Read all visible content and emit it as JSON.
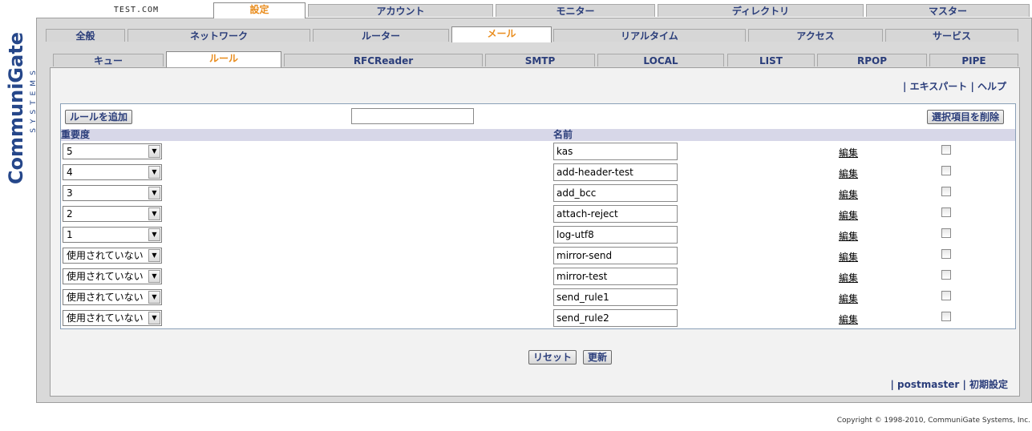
{
  "logo": {
    "brand_a": "Communi",
    "brand_b": "Gate",
    "systems": "SYSTEMS"
  },
  "top_tabs": {
    "host": "TEST.COM",
    "items": [
      "設定",
      "アカウント",
      "モニター",
      "ディレクトリ",
      "マスター"
    ],
    "active": "設定"
  },
  "second_tabs": {
    "items": [
      "全般",
      "ネットワーク",
      "ルーター",
      "メール",
      "リアルタイム",
      "アクセス",
      "サービス"
    ],
    "active": "メール"
  },
  "third_tabs": {
    "items": [
      "キュー",
      "ルール",
      "RFCReader",
      "SMTP",
      "LOCAL",
      "LIST",
      "RPOP",
      "PIPE"
    ],
    "active": "ルール"
  },
  "help": {
    "expert": "| エキスパート",
    "help": "| ヘルプ"
  },
  "rules": {
    "add_button": "ルールを追加",
    "delete_button": "選択項目を削除",
    "search_value": "",
    "col_priority": "重要度",
    "col_name": "名前",
    "edit_label": "編集",
    "rows": [
      {
        "priority": "5",
        "name": "kas"
      },
      {
        "priority": "4",
        "name": "add-header-test"
      },
      {
        "priority": "3",
        "name": "add_bcc"
      },
      {
        "priority": "2",
        "name": "attach-reject"
      },
      {
        "priority": "1",
        "name": "log-utf8"
      },
      {
        "priority": "使用されていない",
        "name": "mirror-send"
      },
      {
        "priority": "使用されていない",
        "name": "mirror-test"
      },
      {
        "priority": "使用されていない",
        "name": "send_rule1"
      },
      {
        "priority": "使用されていない",
        "name": "send_rule2"
      }
    ]
  },
  "actions": {
    "reset": "リセット",
    "update": "更新"
  },
  "footer": {
    "user": "| postmaster",
    "setup": "| 初期設定"
  },
  "copyright": "Copyright © 1998-2010, CommuniGate Systems, Inc."
}
